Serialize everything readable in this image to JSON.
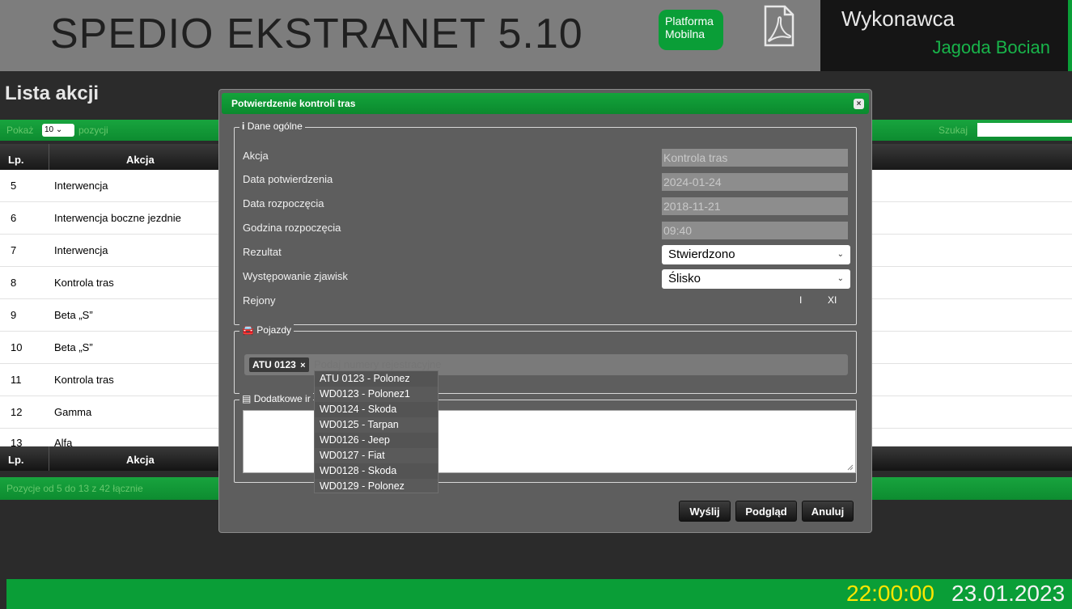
{
  "header": {
    "app_title": "SPEDIO EKSTRANET 5.10",
    "mobile_line1": "Platforma",
    "mobile_line2": "Mobilna",
    "executor_title": "Wykonawca",
    "executor_name": "Jagoda Bocian"
  },
  "page": {
    "title": "Lista akcji",
    "show_label": "Pokaż",
    "show_value": "10",
    "show_label2": "pozycji",
    "search_label": "Szukaj",
    "col_lp": "Lp.",
    "col_action": "Akcja",
    "footer_info": "Pozycje od 5 do 13 z 42 łącznie"
  },
  "rows": [
    {
      "lp": "5",
      "action": "Interwencja"
    },
    {
      "lp": "6",
      "action": "Interwencja boczne jezdnie"
    },
    {
      "lp": "7",
      "action": "Interwencja"
    },
    {
      "lp": "8",
      "action": "Kontrola tras"
    },
    {
      "lp": "9",
      "action": "Beta „S”"
    },
    {
      "lp": "10",
      "action": "Beta „S”"
    },
    {
      "lp": "11",
      "action": "Kontrola tras"
    },
    {
      "lp": "12",
      "action": "Gamma"
    },
    {
      "lp": "13",
      "action": "Alfa"
    }
  ],
  "modal": {
    "title": "Potwierdzenie kontroli tras",
    "general_legend": "Dane ogólne",
    "fields": {
      "action_label": "Akcja",
      "action_value": "Kontrola tras",
      "confirm_date_label": "Data potwierdzenia",
      "confirm_date_value": "2024-01-24",
      "start_date_label": "Data rozpoczęcia",
      "start_date_value": "2018-11-21",
      "start_time_label": "Godzina rozpoczęcia",
      "start_time_value": "09:40",
      "result_label": "Rezultat",
      "result_value": "Stwierdzono",
      "phenomena_label": "Występowanie zjawisk",
      "phenomena_value": "Ślisko",
      "regions_label": "Rejony",
      "region_1": "I",
      "region_2": "XI"
    },
    "vehicles_legend": "Pojazdy",
    "vehicle_tag": "ATU 0123",
    "vehicle_tag_remove": "×",
    "vehicle_placeholder": "Podaj numery rejestracyjne",
    "extra_legend": "Dodatkowe ir",
    "vehicle_options": [
      "ATU 0123 - Polonez",
      "WD0123 - Polonez1",
      "WD0124 - Skoda",
      "WD0125 - Tarpan",
      "WD0126 - Jeep",
      "WD0127 - Fiat",
      "WD0128 - Skoda",
      "WD0129 - Polonez"
    ],
    "send_label": "Wyślij",
    "preview_label": "Podgląd",
    "cancel_label": "Anuluj",
    "close_label": "×"
  },
  "clock": {
    "time": "22:00:00",
    "date": "23.01.2023"
  },
  "colors": {
    "accent_green": "#0a9e37",
    "clock_time": "#ffe600"
  }
}
